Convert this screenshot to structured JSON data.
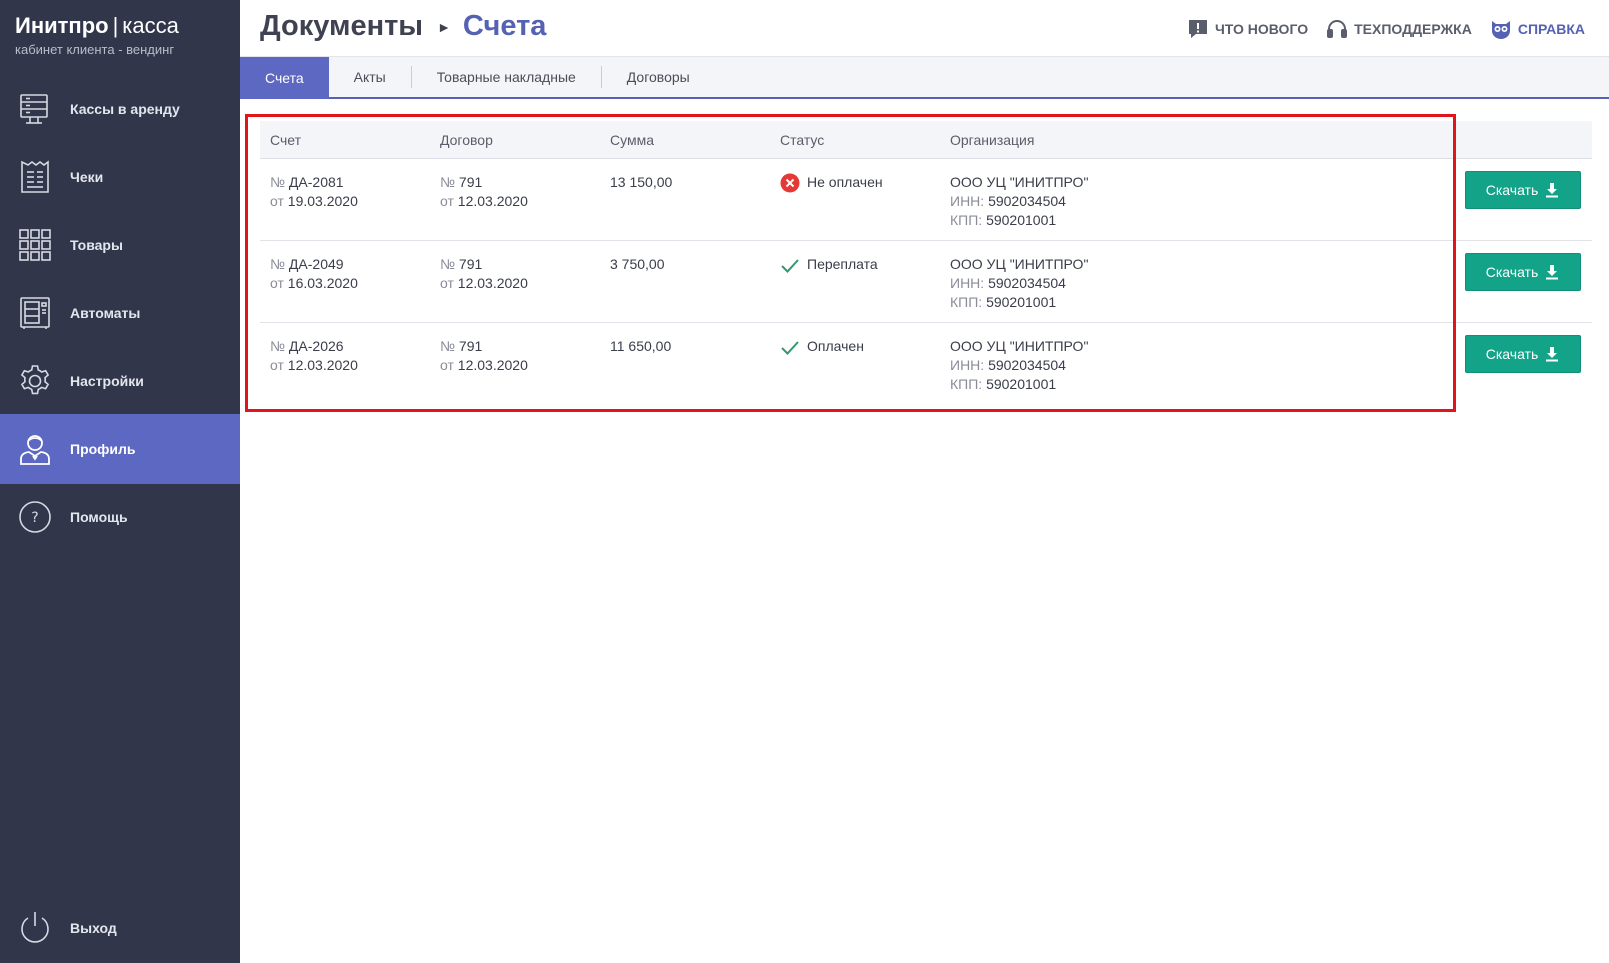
{
  "brand": {
    "name": "Инитпро",
    "separator": "|",
    "product": "касса",
    "subtitle": "кабинет клиента - вендинг"
  },
  "sidebar": {
    "items": [
      {
        "label": "Кассы в аренду",
        "icon": "cash-register-icon"
      },
      {
        "label": "Чеки",
        "icon": "receipt-icon"
      },
      {
        "label": "Товары",
        "icon": "grid-icon"
      },
      {
        "label": "Автоматы",
        "icon": "vending-machine-icon"
      },
      {
        "label": "Настройки",
        "icon": "gear-icon"
      },
      {
        "label": "Профиль",
        "icon": "user-icon",
        "active": true
      },
      {
        "label": "Помощь",
        "icon": "question-icon"
      }
    ],
    "logout": {
      "label": "Выход",
      "icon": "power-icon"
    }
  },
  "header": {
    "breadcrumb_root": "Документы",
    "breadcrumb_current": "Счета",
    "links": {
      "whats_new": "ЧТО НОВОГО",
      "support": "ТЕХПОДДЕРЖКА",
      "help": "СПРАВКА"
    }
  },
  "tabs": [
    "Счета",
    "Акты",
    "Товарные накладные",
    "Договоры"
  ],
  "table": {
    "headers": {
      "invoice": "Счет",
      "contract": "Договор",
      "sum": "Сумма",
      "status": "Статус",
      "org": "Организация"
    },
    "rows": [
      {
        "inv_prefix": "№",
        "inv_no": "ДА-2081",
        "inv_date_prefix": "от",
        "inv_date": "19.03.2020",
        "con_prefix": "№",
        "con_no": "791",
        "con_date_prefix": "от",
        "con_date": "12.03.2020",
        "sum": "13 150,00",
        "status": "Не оплачен",
        "status_type": "unpaid",
        "org_name": "ООО УЦ \"ИНИТПРО\"",
        "inn_label": "ИНН:",
        "inn": "5902034504",
        "kpp_label": "КПП:",
        "kpp": "590201001",
        "button": "Скачать"
      },
      {
        "inv_prefix": "№",
        "inv_no": "ДА-2049",
        "inv_date_prefix": "от",
        "inv_date": "16.03.2020",
        "con_prefix": "№",
        "con_no": "791",
        "con_date_prefix": "от",
        "con_date": "12.03.2020",
        "sum": "3 750,00",
        "status": "Переплата",
        "status_type": "ok",
        "org_name": "ООО УЦ \"ИНИТПРО\"",
        "inn_label": "ИНН:",
        "inn": "5902034504",
        "kpp_label": "КПП:",
        "kpp": "590201001",
        "button": "Скачать"
      },
      {
        "inv_prefix": "№",
        "inv_no": "ДА-2026",
        "inv_date_prefix": "от",
        "inv_date": "12.03.2020",
        "con_prefix": "№",
        "con_no": "791",
        "con_date_prefix": "от",
        "con_date": "12.03.2020",
        "sum": "11 650,00",
        "status": "Оплачен",
        "status_type": "ok",
        "org_name": "ООО УЦ \"ИНИТПРО\"",
        "inn_label": "ИНН:",
        "inn": "5902034504",
        "kpp_label": "КПП:",
        "kpp": "590201001",
        "button": "Скачать"
      }
    ]
  },
  "colors": {
    "sidebar_bg": "#31364a",
    "accent": "#5d68c2",
    "download_button": "#13a389",
    "error": "#e53935",
    "success": "#2e9a6e",
    "highlight_box": "#e0141a"
  }
}
